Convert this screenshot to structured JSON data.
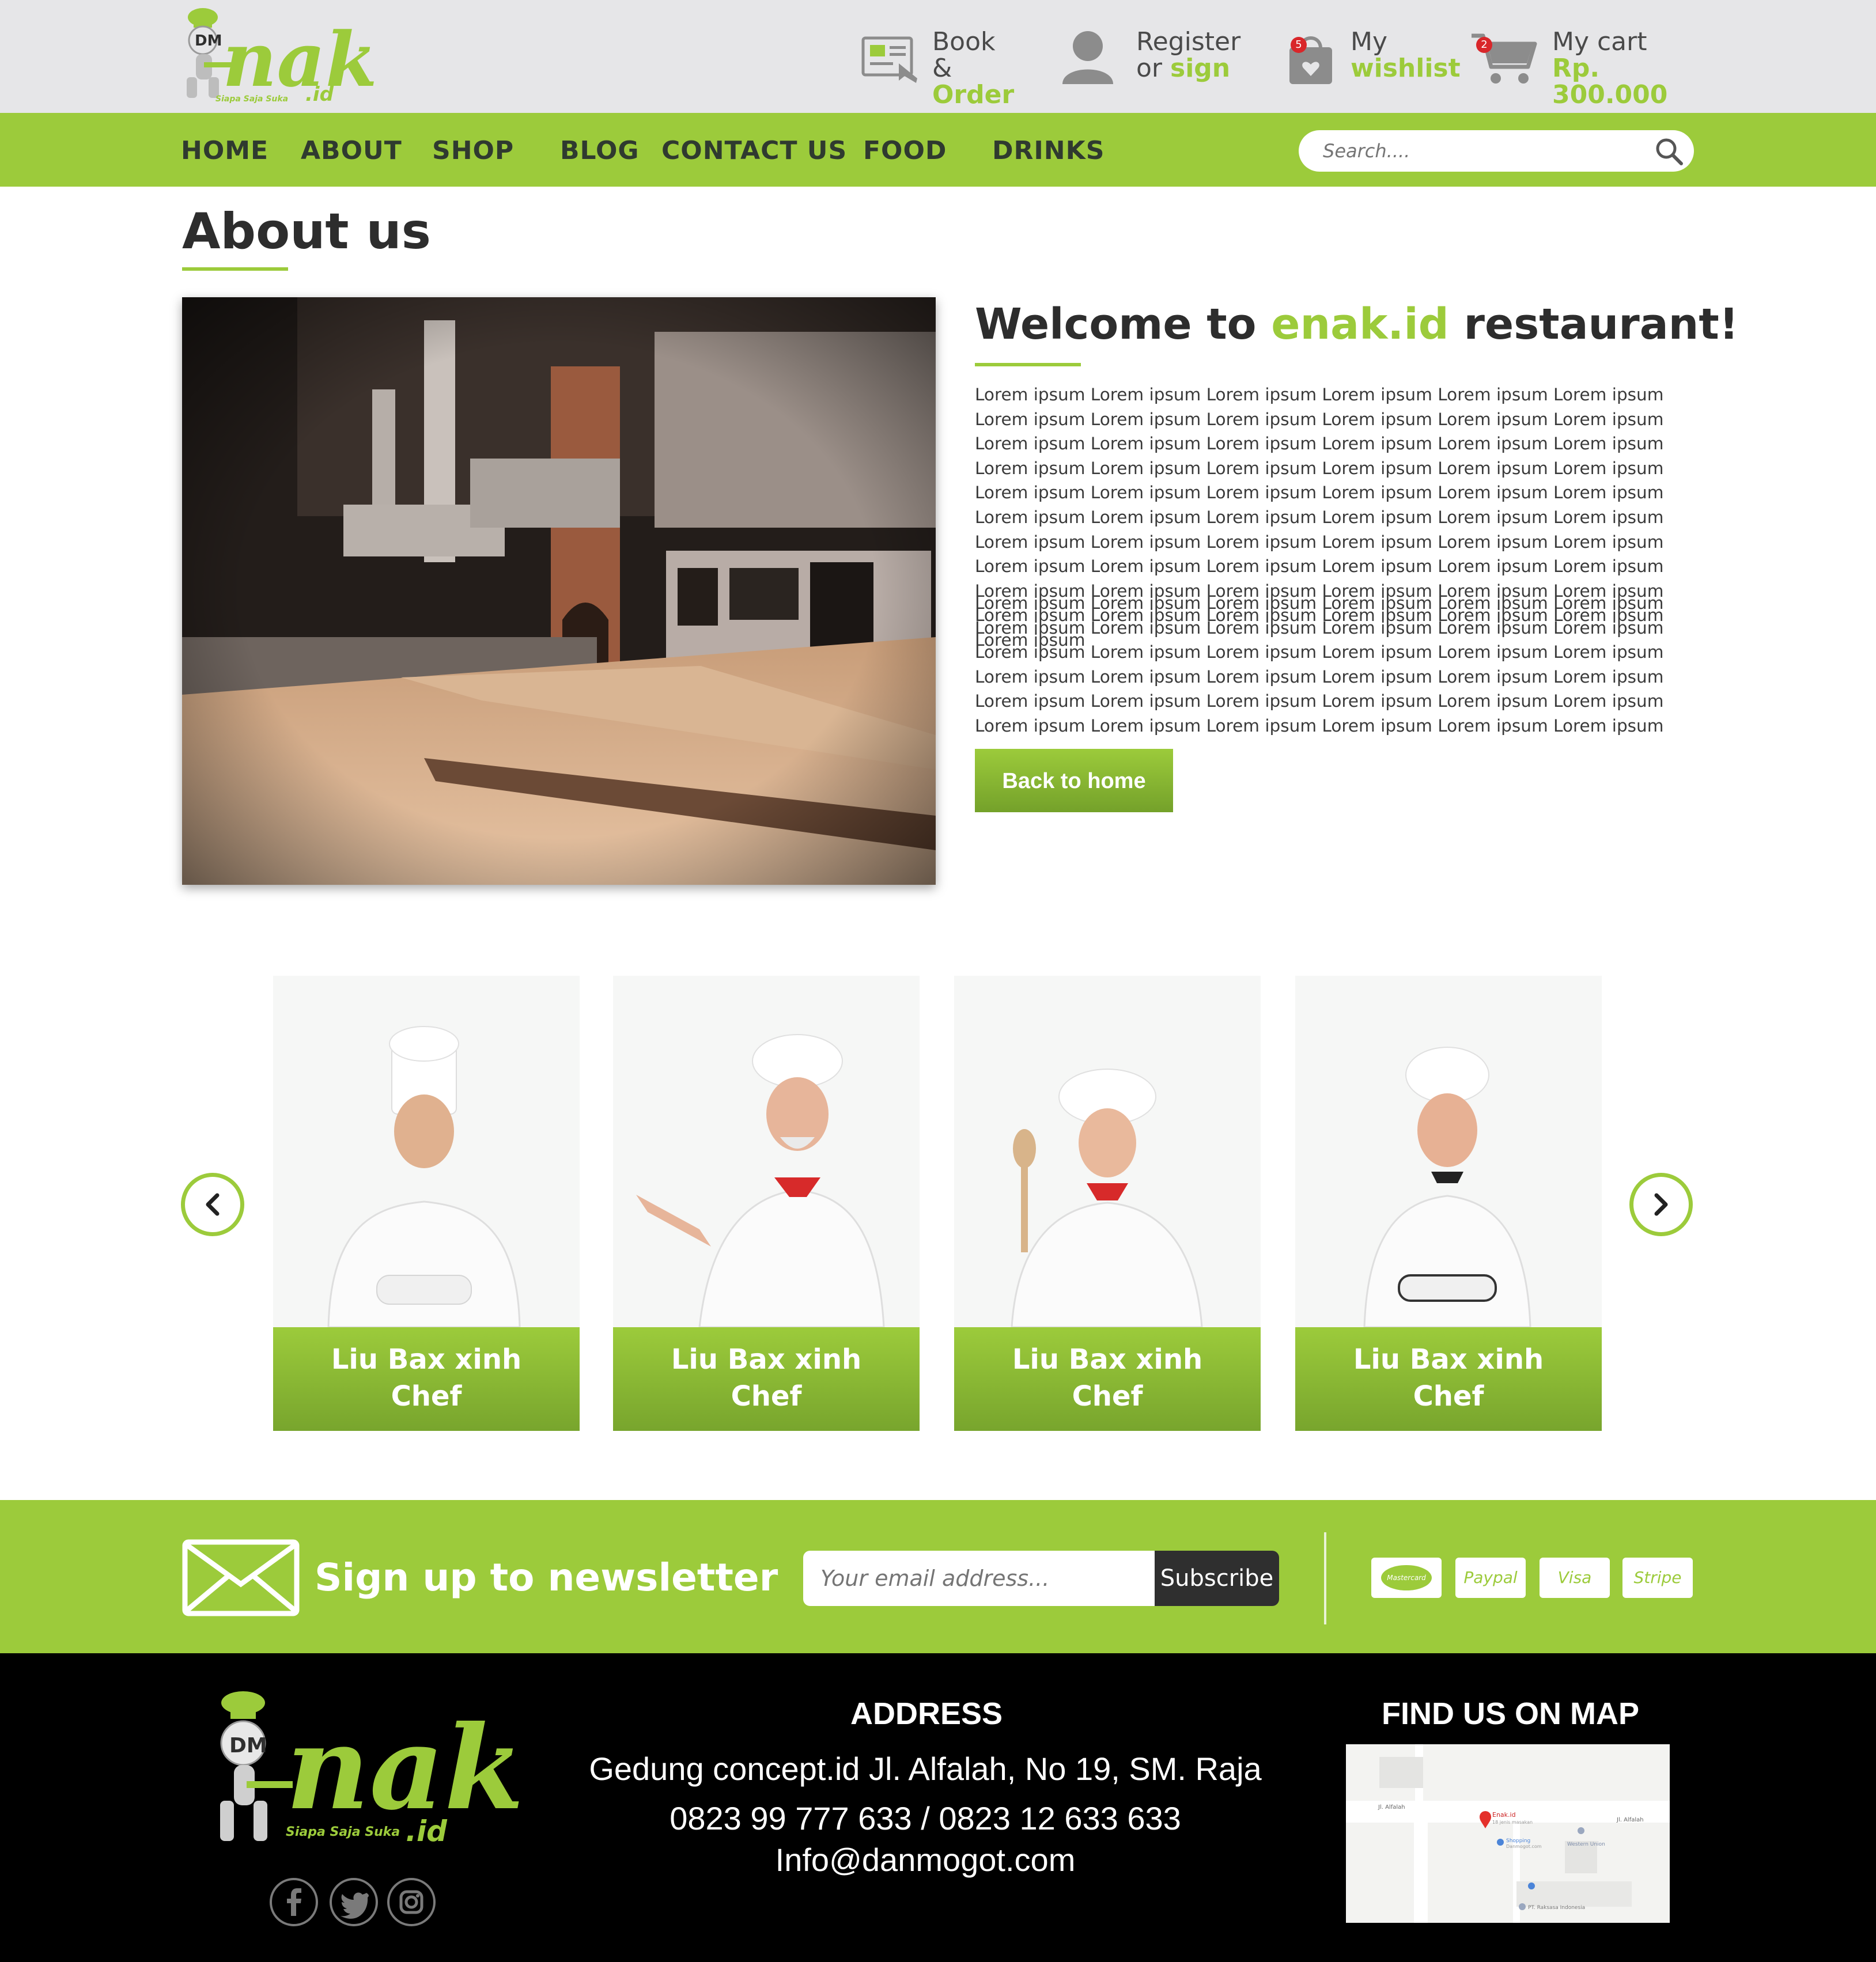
{
  "brand": {
    "logo_mark": "DM",
    "logo_text": "nak",
    "logo_suffix": ".id",
    "tagline": "Siapa Saja Suka",
    "accent": "#9ccb3b",
    "dark": "#2f2f2f"
  },
  "header": {
    "book": {
      "line1": "Book",
      "amp": "& ",
      "line2": "Order",
      "icon": "booking-card-icon"
    },
    "register": {
      "line1": "Register",
      "or": "or ",
      "line2": "sign",
      "icon": "user-icon"
    },
    "wishlist": {
      "line1": "My",
      "line2": "wishlist",
      "badge": "5",
      "icon": "shopping-bag-heart-icon"
    },
    "cart": {
      "line1": "My cart",
      "line2": "Rp. 300.000",
      "badge": "2",
      "icon": "cart-icon"
    }
  },
  "nav": {
    "items": [
      "HOME",
      "ABOUT",
      "SHOP",
      "BLOG",
      "CONTACT US",
      "FOOD",
      "DRINKS"
    ],
    "search_placeholder": "Search...."
  },
  "about": {
    "title": "About us",
    "welcome_pre": "Welcome to ",
    "welcome_brand": "enak.id",
    "welcome_post": " restaurant!",
    "para1": "Lorem ipsum Lorem ipsum Lorem ipsum Lorem ipsum Lorem ipsum Lorem ipsum Lorem ipsum Lorem ipsum Lorem ipsum Lorem ipsum Lorem ipsum Lorem ipsum Lorem ipsum Lorem ipsum Lorem ipsum Lorem ipsum Lorem ipsum Lorem ipsum Lorem ipsum Lorem ipsum Lorem ipsum Lorem ipsum Lorem ipsum Lorem ipsum Lorem ipsum Lorem ipsum Lorem ipsum Lorem ipsum Lorem ipsum Lorem ipsum Lorem ipsum Lorem ipsum Lorem ipsum Lorem ipsum Lorem ipsum Lorem ipsum Lorem ipsum Lorem ipsum Lorem ipsum Lorem ipsum Lorem ipsum Lorem ipsum Lorem ipsum Lorem ipsum Lorem ipsum Lorem ipsum Lorem ipsum Lorem ipsum Lorem ipsum Lorem ipsum Lorem ipsum Lorem ipsum Lorem ipsum Lorem ipsum Lorem ipsum Lorem ipsum Lorem ipsum Lorem ipsum Lorem ipsum Lorem ipsum Lorem ipsum",
    "para2": "Lorem ipsum Lorem ipsum Lorem ipsum Lorem ipsum Lorem ipsum Lorem ipsum Lorem ipsum Lorem ipsum Lorem ipsum Lorem ipsum Lorem ipsum Lorem ipsum Lorem ipsum Lorem ipsum Lorem ipsum Lorem ipsum Lorem ipsum Lorem ipsum Lorem ipsum Lorem ipsum Lorem ipsum Lorem ipsum Lorem ipsum Lorem ipsum Lorem ipsum Lorem ipsum Lorem ipsum Lorem ipsum Lorem ipsum Lorem ipsum Lorem ipsum Lorem ipsum Lorem ipsum Lorem ipsum Lorem ipsum Lorem ipsum",
    "back_button": "Back to home"
  },
  "chefs": [
    {
      "name": "Liu Bax xinh",
      "role": "Chef"
    },
    {
      "name": "Liu Bax xinh",
      "role": "Chef"
    },
    {
      "name": "Liu Bax xinh",
      "role": "Chef"
    },
    {
      "name": "Liu Bax xinh",
      "role": "Chef"
    }
  ],
  "newsletter": {
    "title": "Sign up to newsletter",
    "placeholder": "Your email address...",
    "button": "Subscribe",
    "payments": [
      "Mastercard",
      "Paypal",
      "Visa",
      "Stripe"
    ]
  },
  "footer": {
    "address_title": "ADDRESS",
    "address": "Gedung concept.id Jl. Alfalah, No 19, SM. Raja",
    "phones": "0823 99 777 633 / 0823 12 633 633",
    "email": "Info@danmogot.com",
    "map_title": "FIND US ON MAP",
    "map_labels": {
      "street1": "Jl. Alfalah",
      "street2": "Jl. Alfalah",
      "pin": "Enak.id",
      "pin_sub": "18 jenis masakan",
      "shop": "Shopping",
      "shop_sub": "Danmogot.com",
      "western": "Western Union",
      "company": "PT. Raksasa Indonesia"
    },
    "social": [
      "facebook-icon",
      "twitter-icon",
      "instagram-icon"
    ]
  }
}
